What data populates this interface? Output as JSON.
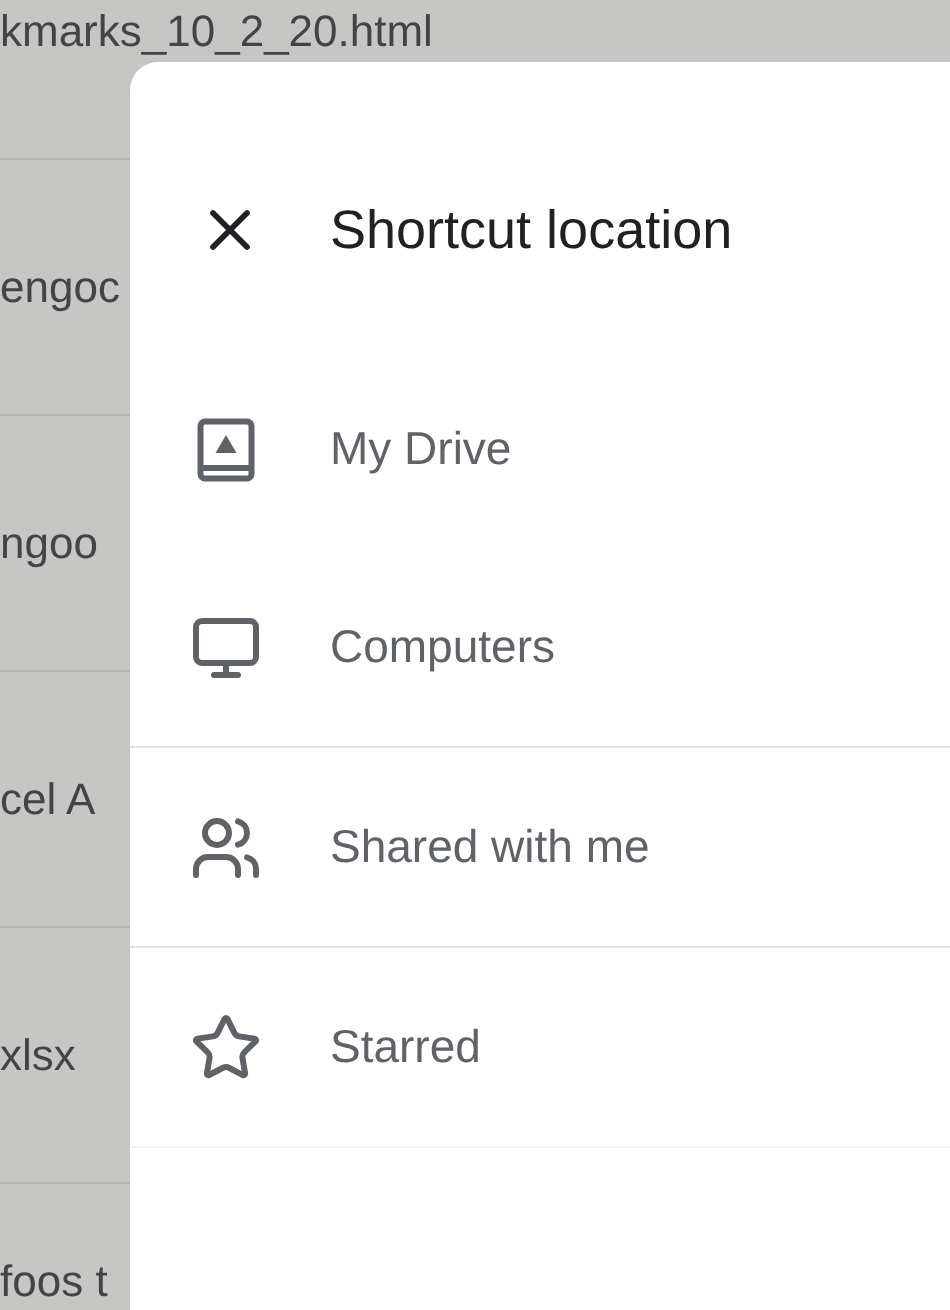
{
  "background_list": {
    "rows": [
      "kmarks_10_2_20.html",
      "engoc",
      "ngoo",
      "cel A",
      "xlsx",
      "foos t"
    ]
  },
  "sheet": {
    "title": "Shortcut location",
    "sections": [
      [
        {
          "kind": "drive",
          "label": "My Drive"
        },
        {
          "kind": "computers",
          "label": "Computers"
        }
      ],
      [
        {
          "kind": "shared",
          "label": "Shared with me"
        }
      ],
      [
        {
          "kind": "starred",
          "label": "Starred"
        }
      ]
    ]
  }
}
